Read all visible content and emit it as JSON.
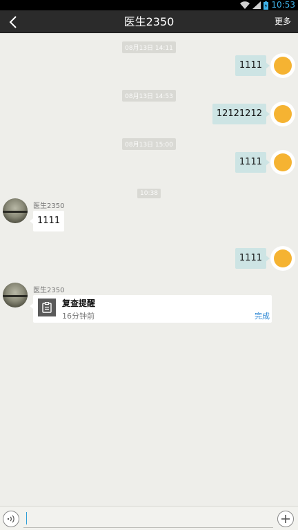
{
  "status_bar": {
    "time": "10:53",
    "wifi_icon": "wifi-icon",
    "signal_icon": "signal-icon",
    "battery_icon": "battery-icon"
  },
  "header": {
    "title": "医生2350",
    "more_label": "更多",
    "back_icon": "chevron-left-icon"
  },
  "messages": [
    {
      "type": "timestamp",
      "text": "08月13日 14:11"
    },
    {
      "type": "outgoing",
      "text": "1111"
    },
    {
      "type": "timestamp",
      "text": "08月13日 14:53"
    },
    {
      "type": "outgoing",
      "text": "12121212"
    },
    {
      "type": "timestamp",
      "text": "08月13日 15:00"
    },
    {
      "type": "outgoing",
      "text": "1111"
    },
    {
      "type": "timestamp",
      "text": "10:38"
    },
    {
      "type": "incoming",
      "sender": "医生2350",
      "text": "1111"
    },
    {
      "type": "outgoing",
      "text": "1111"
    },
    {
      "type": "incoming_card",
      "sender": "医生2350",
      "title": "复查提醒",
      "subtitle": "16分钟前",
      "action": "完成",
      "icon": "clipboard-icon"
    }
  ],
  "input_bar": {
    "voice_icon": "voice-icon",
    "plus_icon": "plus-icon",
    "value": ""
  },
  "colors": {
    "header_bg": "#2b2b2b",
    "outgoing_bubble": "#cde4e4",
    "self_avatar": "#f5b332",
    "action_blue": "#2e88d4",
    "chat_bg": "#eeeeea"
  }
}
